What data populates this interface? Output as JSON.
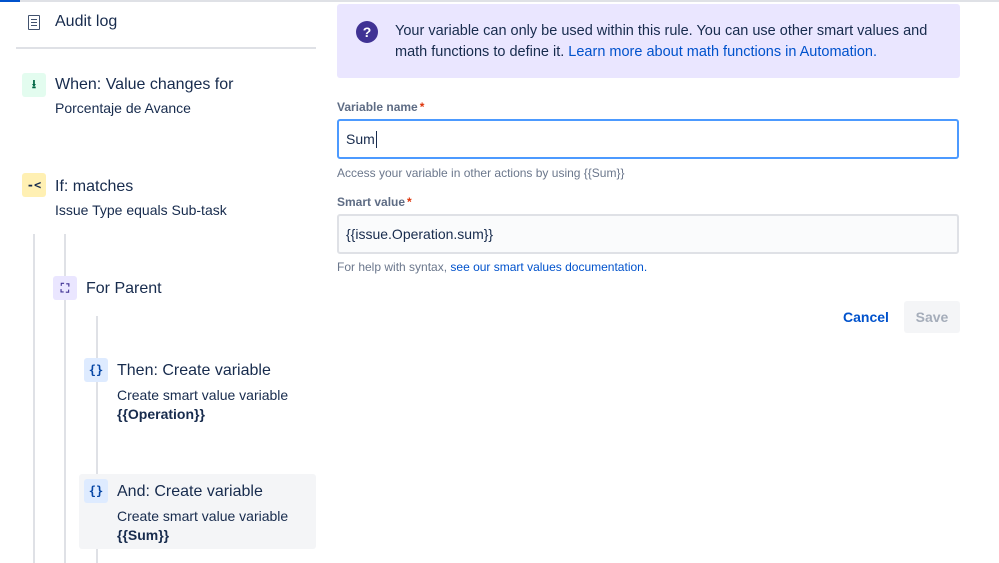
{
  "sidebar": {
    "audit_log": "Audit log",
    "steps": [
      {
        "type": "trigger",
        "icon": "value-change-icon",
        "glyph": "⭳",
        "title": "When: Value changes for",
        "sub": "Porcentaje de Avance"
      },
      {
        "type": "condition",
        "icon": "branch-condition-icon",
        "glyph": "-<",
        "title": "If: matches",
        "sub": "Issue Type equals Sub-task"
      },
      {
        "type": "branch",
        "icon": "hierarchy-icon",
        "glyph": "⛶",
        "title": "For Parent"
      },
      {
        "type": "action",
        "icon": "curly-braces-icon",
        "glyph": "{}",
        "title": "Then: Create variable",
        "sub": "Create smart value variable",
        "sub2": "{{Operation}}"
      },
      {
        "type": "action",
        "icon": "curly-braces-icon",
        "glyph": "{}",
        "title": "And: Create variable",
        "sub": "Create smart value variable",
        "sub2": "{{Sum}}",
        "selected": true
      }
    ]
  },
  "info": {
    "icon": "question-icon",
    "text": "Your variable can only be used within this rule. You can use other smart values and math functions to define it. ",
    "link": "Learn more about math functions in Automation."
  },
  "form": {
    "variable_name_label": "Variable name",
    "required_mark": "*",
    "variable_name_value": "Sum",
    "variable_name_help": "Access your variable in other actions by using {{Sum}}",
    "smart_value_label": "Smart value",
    "smart_value_value": "{{issue.Operation.sum}}",
    "smart_value_help_prefix": "For help with syntax, ",
    "smart_value_help_link": "see our smart values documentation."
  },
  "actions": {
    "cancel": "Cancel",
    "save": "Save"
  },
  "colors": {
    "accent": "#0052cc",
    "info_bg": "#eae6ff",
    "focus": "#4c9aff",
    "required": "#de350b"
  }
}
